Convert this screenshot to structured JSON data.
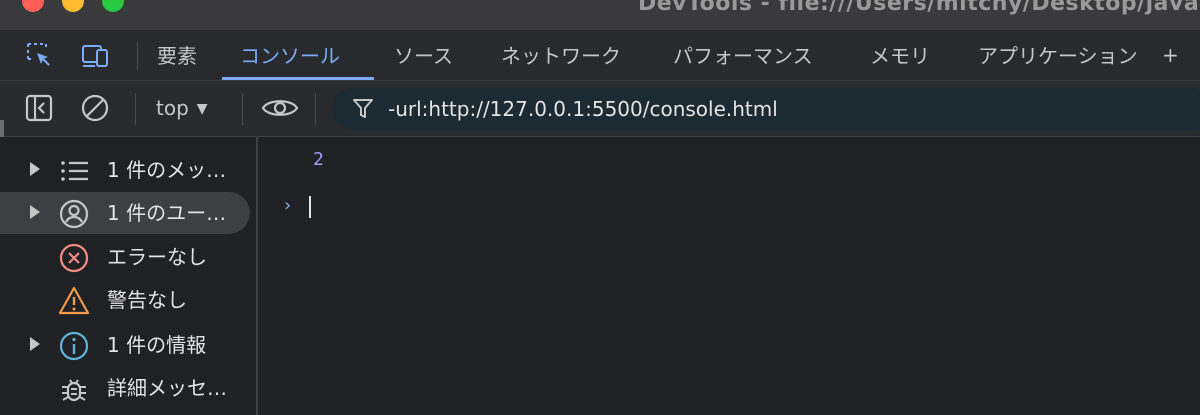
{
  "window": {
    "title": "DevTools - file:///Users/mitchy/Desktop/java"
  },
  "tabs": [
    {
      "label": "要素",
      "active": false
    },
    {
      "label": "コンソール",
      "active": true
    },
    {
      "label": "ソース",
      "active": false
    },
    {
      "label": "ネットワーク",
      "active": false
    },
    {
      "label": "パフォーマンス",
      "active": false
    },
    {
      "label": "メモリ",
      "active": false
    },
    {
      "label": "アプリケーション",
      "active": false
    }
  ],
  "tabs_more": "+",
  "toolbar": {
    "context": "top",
    "filter_value": "-url:http://127.0.0.1:5500/console.html"
  },
  "sidebar": {
    "items": [
      {
        "label": "1 件のメッ…",
        "icon": "list-icon",
        "expandable": true,
        "selected": false
      },
      {
        "label": "1 件のユー…",
        "icon": "user-icon",
        "expandable": true,
        "selected": true
      },
      {
        "label": "エラーなし",
        "icon": "error-icon",
        "expandable": false,
        "selected": false
      },
      {
        "label": "警告なし",
        "icon": "warning-icon",
        "expandable": false,
        "selected": false
      },
      {
        "label": "1 件の情報",
        "icon": "info-icon",
        "expandable": true,
        "selected": false
      },
      {
        "label": "詳細メッセ…",
        "icon": "bug-icon",
        "expandable": false,
        "selected": false
      }
    ]
  },
  "console": {
    "output": "2",
    "prompt": "›"
  },
  "colors": {
    "accent": "#7cacf8",
    "background": "#202124",
    "toolbar": "#282a2d",
    "error": "#f28b82",
    "warning": "#f29a4a",
    "info": "#5fb3d9",
    "number": "#9e9cf8"
  }
}
